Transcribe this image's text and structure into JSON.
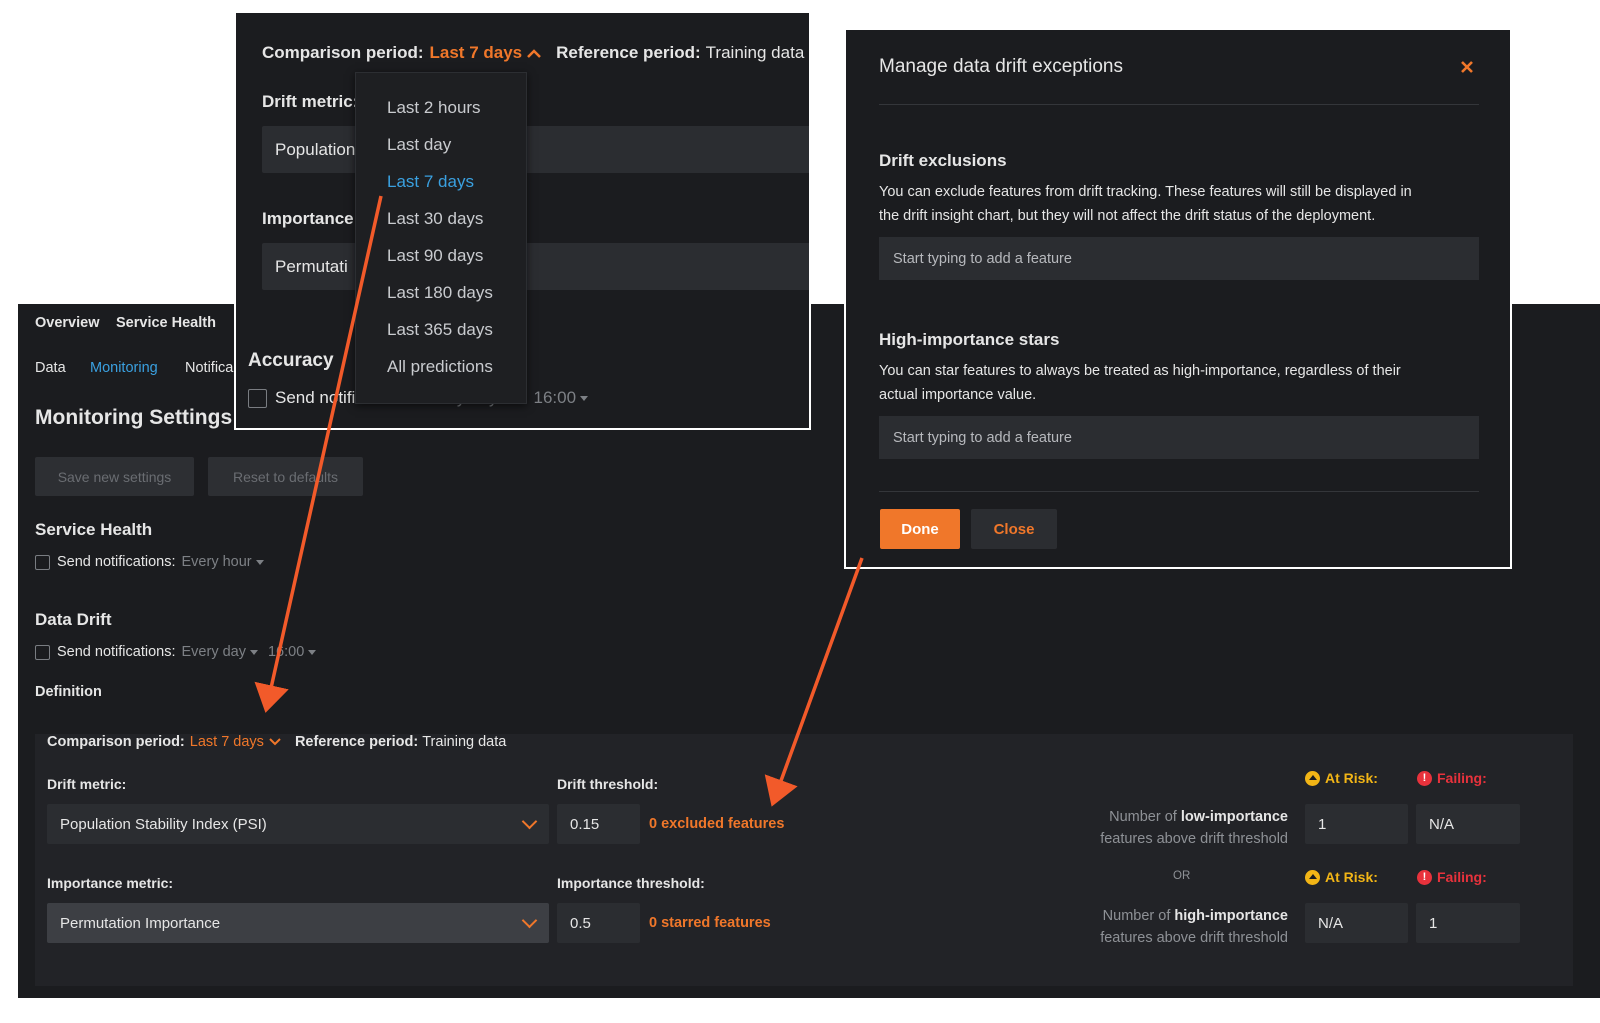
{
  "main": {
    "top_tabs": [
      "Overview",
      "Service Health"
    ],
    "sub_tabs": [
      {
        "label": "Data",
        "active": false
      },
      {
        "label": "Monitoring",
        "active": true
      },
      {
        "label": "Notifica",
        "active": false
      }
    ],
    "page_title": "Monitoring Settings",
    "save_button": "Save new settings",
    "reset_button": "Reset to defaults",
    "service_health": {
      "heading": "Service Health",
      "send_label": "Send notifications:",
      "frequency": "Every hour"
    },
    "data_drift": {
      "heading": "Data Drift",
      "send_label": "Send notifications:",
      "frequency": "Every day",
      "time": "16:00"
    },
    "definition": {
      "heading": "Definition",
      "comparison_label": "Comparison period:",
      "comparison_value": "Last 7 days",
      "reference_label": "Reference period:",
      "reference_value": "Training data",
      "drift_metric_label": "Drift metric:",
      "drift_metric_value": "Population Stability Index (PSI)",
      "drift_threshold_label": "Drift threshold:",
      "drift_threshold_value": "0.15",
      "excluded_link": "0 excluded features",
      "importance_metric_label": "Importance metric:",
      "importance_metric_value": "Permutation Importance",
      "importance_threshold_label": "Importance threshold:",
      "importance_threshold_value": "0.5",
      "starred_link": "0 starred features",
      "at_risk_label": "At Risk:",
      "failing_label": "Failing:",
      "low_prefix": "Number of",
      "low_strong": "low-importance",
      "low_suffix": "features above drift threshold",
      "low_at_risk": "1",
      "low_failing": "N/A",
      "or_label": "OR",
      "high_prefix": "Number of",
      "high_strong": "high-importance",
      "high_suffix": "features above drift threshold",
      "high_at_risk": "N/A",
      "high_failing": "1"
    }
  },
  "popup": {
    "comparison_label": "Comparison period:",
    "comparison_value": "Last 7 days",
    "reference_label": "Reference period:",
    "reference_value": "Training data",
    "drift_metric_label": "Drift metric:",
    "drift_metric_partial": "Population",
    "importance_label": "Importance",
    "importance_partial": "Permutati",
    "accuracy_heading": "Accuracy",
    "send_partial": "Send notifications:",
    "frequency": "Every day",
    "time": "16:00",
    "dropdown_options": [
      {
        "label": "Last 2 hours",
        "selected": false
      },
      {
        "label": "Last day",
        "selected": false
      },
      {
        "label": "Last 7 days",
        "selected": true
      },
      {
        "label": "Last 30 days",
        "selected": false
      },
      {
        "label": "Last 90 days",
        "selected": false
      },
      {
        "label": "Last 180 days",
        "selected": false
      },
      {
        "label": "Last 365 days",
        "selected": false
      },
      {
        "label": "All predictions",
        "selected": false
      }
    ]
  },
  "modal": {
    "title": "Manage data drift exceptions",
    "exclusions_heading": "Drift exclusions",
    "exclusions_text_1": "You can exclude features from drift tracking. These features will still be displayed in",
    "exclusions_text_2": "the drift insight chart, but they will not affect the drift status of the deployment.",
    "exclusions_placeholder": "Start typing to add a feature",
    "stars_heading": "High-importance stars",
    "stars_text_1": "You can star features to always be treated as high-importance, regardless of their",
    "stars_text_2": "actual importance value.",
    "stars_placeholder": "Start typing to add a feature",
    "done_button": "Done",
    "close_button": "Close"
  },
  "colors": {
    "accent": "#f0772a",
    "link_blue": "#3aa0e0",
    "background": "#1b1c1f",
    "at_risk": "#f2b516",
    "failing": "#e8323c",
    "arrow": "#f25a2a"
  },
  "icons": [
    "close-icon",
    "chevron-up-icon",
    "chevron-down-icon",
    "caret-down-icon",
    "warning-icon",
    "error-icon"
  ]
}
